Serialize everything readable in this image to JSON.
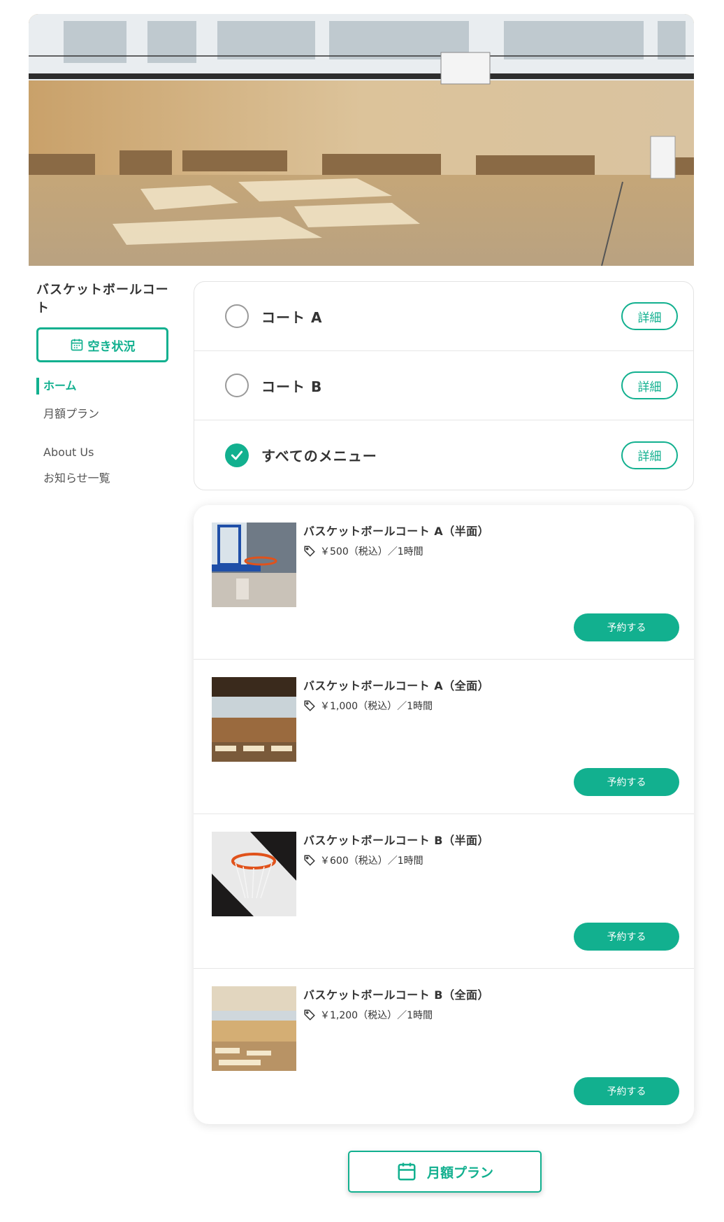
{
  "hero": {
    "image": "gymnasium-basketball-court-photo"
  },
  "sidebar": {
    "title": "バスケットボールコート",
    "availability_button": "空き状況",
    "nav": [
      {
        "label": "ホーム",
        "active": true
      },
      {
        "label": "月額プラン"
      },
      {
        "label": "About Us"
      },
      {
        "label": "お知らせ一覧"
      }
    ]
  },
  "selector": {
    "rows": [
      {
        "label": "コート A",
        "checked": false,
        "detail": "詳細"
      },
      {
        "label": "コート B",
        "checked": false,
        "detail": "詳細"
      },
      {
        "label": "すべてのメニュー",
        "checked": true,
        "detail": "詳細"
      }
    ]
  },
  "menu": {
    "items": [
      {
        "title": "バスケットボールコート A（半面）",
        "price": "￥500（税込）／1時間",
        "button": "予約する",
        "image": "hoop-with-ball-photo"
      },
      {
        "title": "バスケットボールコート A（全面）",
        "price": "￥1,000（税込）／1時間",
        "button": "予約する",
        "image": "gym-interior-photo"
      },
      {
        "title": "バスケットボールコート B（半面）",
        "price": "￥600（税込）／1時間",
        "button": "予約する",
        "image": "hoop-net-closeup-photo"
      },
      {
        "title": "バスケットボールコート B（全面）",
        "price": "￥1,200（税込）／1時間",
        "button": "予約する",
        "image": "gym-floor-photo"
      }
    ]
  },
  "footer": {
    "monthly_button": "月額プラン"
  },
  "colors": {
    "accent": "#12b08f",
    "text": "#333333",
    "border": "#e3e3e3"
  },
  "icons": {
    "calendar": "calendar-icon",
    "tag": "tag-icon",
    "check": "check-icon"
  }
}
